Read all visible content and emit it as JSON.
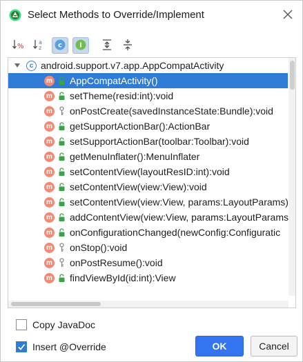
{
  "window": {
    "title": "Select Methods to Override/Implement",
    "app_icon": "android-studio-icon",
    "close_icon": "close-icon"
  },
  "toolbar": {
    "buttons": [
      {
        "name": "sort-by-visibility-icon",
        "active": false
      },
      {
        "name": "sort-alphabetically-icon",
        "active": false
      },
      {
        "name": "show-classes-icon",
        "active": true
      },
      {
        "name": "show-interfaces-icon",
        "active": true
      },
      {
        "name": "expand-all-icon",
        "active": false
      },
      {
        "name": "collapse-all-icon",
        "active": false
      }
    ]
  },
  "tree": {
    "root": {
      "label": "android.support.v7.app.AppCompatActivity",
      "expanded": true
    },
    "items": [
      {
        "label": "AppCompatActivity()",
        "visibility": "public",
        "selected": true
      },
      {
        "label": "setTheme(resid:int):void",
        "visibility": "public",
        "selected": false
      },
      {
        "label": "onPostCreate(savedInstanceState:Bundle):void",
        "visibility": "protected",
        "selected": false
      },
      {
        "label": "getSupportActionBar():ActionBar",
        "visibility": "public",
        "selected": false
      },
      {
        "label": "setSupportActionBar(toolbar:Toolbar):void",
        "visibility": "public",
        "selected": false
      },
      {
        "label": "getMenuInflater():MenuInflater",
        "visibility": "public",
        "selected": false
      },
      {
        "label": "setContentView(layoutResID:int):void",
        "visibility": "public",
        "selected": false
      },
      {
        "label": "setContentView(view:View):void",
        "visibility": "public",
        "selected": false
      },
      {
        "label": "setContentView(view:View, params:LayoutParams)",
        "visibility": "public",
        "selected": false
      },
      {
        "label": "addContentView(view:View, params:LayoutParams",
        "visibility": "public",
        "selected": false
      },
      {
        "label": "onConfigurationChanged(newConfig:Configuratic",
        "visibility": "public",
        "selected": false
      },
      {
        "label": "onStop():void",
        "visibility": "protected",
        "selected": false
      },
      {
        "label": "onPostResume():void",
        "visibility": "protected",
        "selected": false
      },
      {
        "label": "findViewById(id:int):View",
        "visibility": "public",
        "selected": false
      }
    ],
    "method_badge": "m",
    "class_badge": "c"
  },
  "options": {
    "copy_javadoc": {
      "label": "Copy JavaDoc",
      "checked": false
    },
    "insert_override": {
      "label": "Insert @Override",
      "checked": true
    }
  },
  "buttons": {
    "ok": "OK",
    "cancel": "Cancel"
  },
  "colors": {
    "selection": "#2f7cd6",
    "method_badge": "#f08a77",
    "ok_button": "#3574f0",
    "public_lock": "#3aa34a",
    "protected_key": "#8a8a8a"
  }
}
